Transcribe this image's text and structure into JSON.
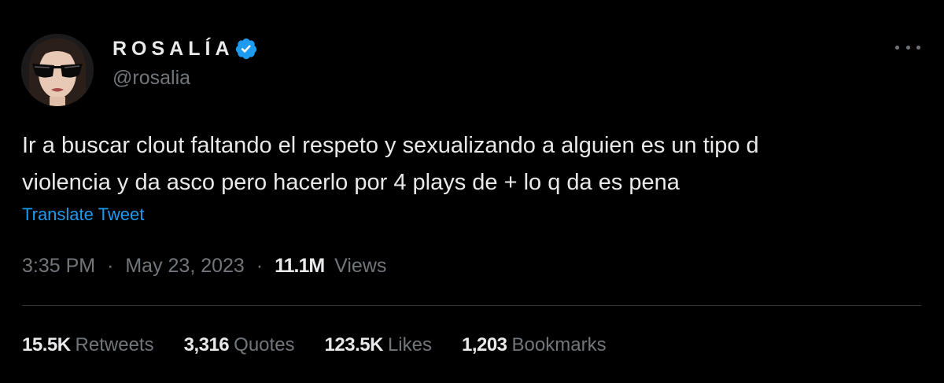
{
  "author": {
    "display_name": "ROSALÍA",
    "handle": "@rosalia",
    "verified_icon": "verified-badge-icon",
    "avatar_icon": "profile-avatar"
  },
  "more_icon": "more-options-icon",
  "tweet": {
    "text_lines": [
      "Ir a buscar clout faltando el respeto y sexualizando a alguien es un tipo d",
      "violencia y da asco pero hacerlo por 4 plays de + lo q da es pena"
    ],
    "translate_label": "Translate Tweet",
    "time": "3:35 PM",
    "separator": "·",
    "date": "May 23, 2023",
    "views_count": "11.1M",
    "views_label": "Views"
  },
  "stats": [
    {
      "count": "15.5K",
      "label": "Retweets"
    },
    {
      "count": "3,316",
      "label": "Quotes"
    },
    {
      "count": "123.5K",
      "label": "Likes"
    },
    {
      "count": "1,203",
      "label": "Bookmarks"
    }
  ],
  "colors": {
    "background": "#000000",
    "text_primary": "#e7e9ea",
    "text_secondary": "#71767b",
    "link": "#1d9bf0",
    "divider": "#2f3336"
  }
}
